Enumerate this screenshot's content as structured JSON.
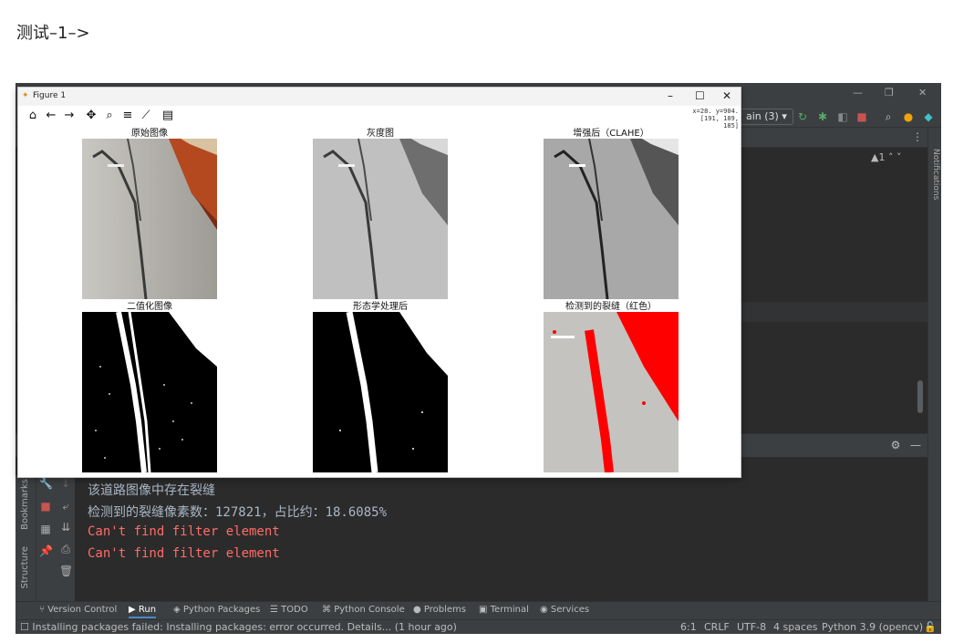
{
  "heading": "测试–1–>",
  "ide": {
    "branch_label": "ain (3)",
    "warning_count": "▲1",
    "notifications_label": "Notifications",
    "left_rail": {
      "bookmarks": "Bookmarks",
      "structure": "Structure"
    },
    "console_lines": [
      {
        "text": "该道路图像中存在裂缝",
        "color": "#a9b7c6"
      },
      {
        "text": "检测到的裂缝像素数：127821，占比约：18.6085%",
        "color": "#a9b7c6"
      },
      {
        "text": "Can't find filter element",
        "color": "#ff6b68"
      },
      {
        "text": "Can't find filter element",
        "color": "#ff6b68"
      }
    ],
    "bottom_tabs": [
      {
        "label": "Version Control",
        "icon": "branch-icon"
      },
      {
        "label": "Run",
        "icon": "run-icon"
      },
      {
        "label": "Python Packages",
        "icon": "packages-icon"
      },
      {
        "label": "TODO",
        "icon": "todo-icon"
      },
      {
        "label": "Python Console",
        "icon": "python-console-icon"
      },
      {
        "label": "Problems",
        "icon": "problems-icon"
      },
      {
        "label": "Terminal",
        "icon": "terminal-icon"
      },
      {
        "label": "Services",
        "icon": "services-icon"
      }
    ],
    "status": {
      "message": "Installing packages failed: Installing packages: error occurred. Details... (1 hour ago)",
      "position": "6:1",
      "line_ending": "CRLF",
      "encoding": "UTF-8",
      "indent": "4 spaces",
      "interpreter": "Python 3.9 (opencv)"
    }
  },
  "figure": {
    "title": "Figure 1",
    "coords_line1": "x=28. y=904.",
    "coords_line2": "[191, 189, 185]",
    "panels": [
      {
        "title": "原始图像",
        "kind": "original"
      },
      {
        "title": "灰度图",
        "kind": "gray"
      },
      {
        "title": "增强后（CLAHE）",
        "kind": "clahe"
      },
      {
        "title": "二值化图像",
        "kind": "binary"
      },
      {
        "title": "形态学处理后",
        "kind": "morph"
      },
      {
        "title": "检测到的裂缝（红色）",
        "kind": "detected"
      }
    ]
  },
  "colors": {
    "ide_bg": "#2b2b2b",
    "console_text": "#a9b7c6",
    "error_text": "#ff6b68",
    "crack_red": "#ff0000"
  }
}
